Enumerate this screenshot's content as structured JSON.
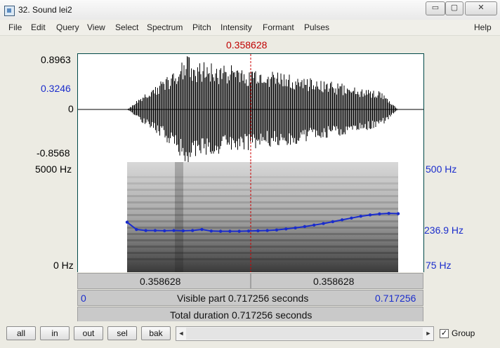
{
  "window": {
    "title": "32. Sound lei2",
    "minimize": "▭",
    "maximize": "▢",
    "close": "✕"
  },
  "menu": [
    "File",
    "Edit",
    "Query",
    "View",
    "Select",
    "Spectrum",
    "Pitch",
    "Intensity",
    "Formant",
    "Pulses",
    "Help"
  ],
  "cursor": {
    "time": "0.358628",
    "fraction": 0.5
  },
  "waveform": {
    "ymax": "0.8963",
    "ycursor": "0.3246",
    "yzero": "0",
    "ymin": "-0.8568"
  },
  "spectrogram": {
    "fmax": "5000 Hz",
    "fmin": "0 Hz",
    "pitch_max": "500 Hz",
    "pitch_mid": "236.9 Hz",
    "pitch_min": "75 Hz"
  },
  "pitch_track_hz": [
    268,
    240,
    236,
    236,
    235,
    236,
    235,
    236,
    240,
    234,
    233,
    233,
    233,
    234,
    235,
    236,
    238,
    242,
    246,
    251,
    257,
    263,
    270,
    277,
    284,
    291,
    296,
    300,
    302,
    301
  ],
  "bars": {
    "left_segment": "0.358628",
    "right_segment": "0.358628",
    "visible_start": "0",
    "visible_text": "Visible part 0.717256 seconds",
    "visible_end": "0.717256",
    "total_text": "Total duration 0.717256 seconds"
  },
  "buttons": [
    "all",
    "in",
    "out",
    "sel",
    "bak"
  ],
  "group": {
    "label": "Group",
    "checked": true,
    "mark": "✓"
  },
  "scroll_arrows": [
    "◄",
    "►"
  ],
  "colors": {
    "cursor": "#cc0000",
    "pitch": "#1a2ccc",
    "box_border": "#004848"
  }
}
